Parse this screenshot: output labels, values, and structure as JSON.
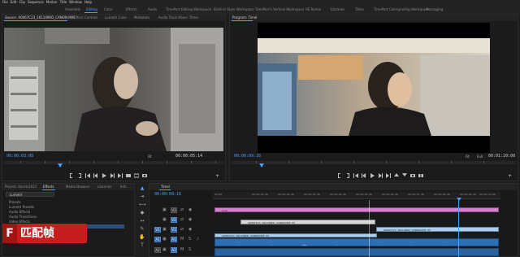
{
  "menu": [
    "File",
    "Edit",
    "Clip",
    "Sequence",
    "Marker",
    "Title",
    "Window",
    "Help"
  ],
  "workspaces": {
    "items": [
      "Assembly",
      "Editing",
      "Color",
      "Effects",
      "Audio",
      "TimePart Editing Workspace",
      "DaVinci Style Workspace",
      "TimePart's Vertical Workspace",
      "AE Remix",
      "Libraries",
      "Titles",
      "TimePart Colorgrading Workspace",
      "Messaging"
    ],
    "active": "Editing"
  },
  "source": {
    "tabs": [
      "Source: A0067C23_161109RD_CANON.MXF",
      "Effect Controls",
      "Lumetri Color",
      "Metadata",
      "Audio Track Mixer: Timel"
    ],
    "timecode_in": "00:00:03:08",
    "zoom": "Fit",
    "timecode_out": "00:00:05:14"
  },
  "program": {
    "tabs": [
      "Program: Timel"
    ],
    "timecode_in": "00:00:09:16",
    "zoom": "Fit",
    "quality": "Full",
    "timecode_out": "00:01:20:00"
  },
  "project": {
    "tabs": [
      "Project: Shorts2021",
      "Effects",
      "Media Browser",
      "Libraries",
      "Info"
    ],
    "search": "Lumetri",
    "tree": [
      "Presets",
      "Lumetri Presets",
      "Audio Effects",
      "Audio Transitions",
      "Video Effects"
    ]
  },
  "timeline": {
    "tab": "Timel",
    "timecode": "00:00:09:16",
    "ruler": [
      "00:00",
      "00:00:01:00",
      "00:00:02:00",
      "00:00:03:00",
      "00:00:04:00",
      "00:00:05:00",
      "00:00:06:00",
      "00:00:07:00",
      "00:00:08:00",
      "00:00:09:00",
      "00:00:10:00",
      "00:00:11:0"
    ],
    "tracks": [
      "V3",
      "V2",
      "V1",
      "A1",
      "A2"
    ],
    "clips": {
      "crop": "Crop",
      "v2": "A0067C23_161109RD_CANON.MXF [V]",
      "v1": "A0067C23_161109RD_CANON.MXF [V]",
      "v1b": "A0067C23_161109RD_CANON.MXF [V]"
    }
  },
  "watermark": {
    "letter": "F",
    "text": "匹配帧"
  },
  "colors": {
    "accent": "#4a9fff",
    "crop_clip": "#d77fd0",
    "video_clip": "#d8d8d8",
    "v1_clip": "#a8cef0",
    "audio": "#2d6fb5"
  }
}
